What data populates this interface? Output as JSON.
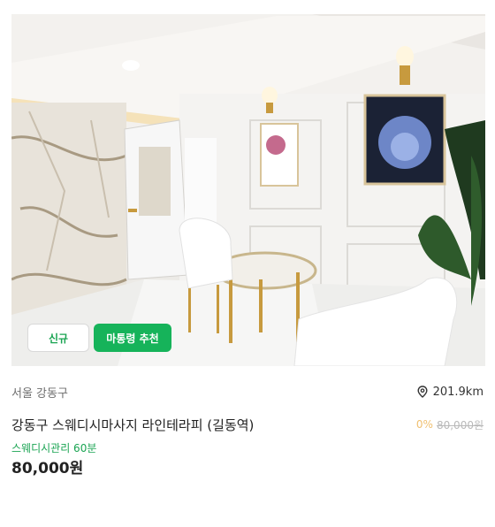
{
  "listing": {
    "photo_alt": "",
    "badges": {
      "new": "신규",
      "recommended": "마통령 추천"
    },
    "location": "서울 강동구",
    "distance": "201.9km",
    "title": "강동구 스웨디시마사지 라인테라피 (길동역)",
    "discount_rate": "0%",
    "original_price": "80,000원",
    "course": "스웨디시관리 60분",
    "price": "80,000원"
  },
  "icons": {
    "distance": "map-pin-icon"
  },
  "colors": {
    "accent_green": "#16b35a",
    "discount": "#f0c070"
  }
}
